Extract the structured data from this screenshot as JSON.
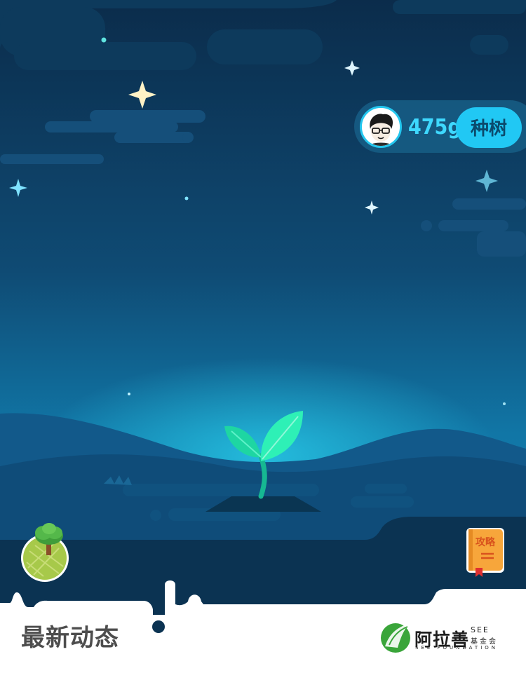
{
  "energy": {
    "amount": "475g",
    "plant_button_label": "种树"
  },
  "guide": {
    "label": "攻略"
  },
  "feed": {
    "title": "最新动态"
  },
  "partner": {
    "name": "阿拉善",
    "abbr": "SEE",
    "sub": "基金会",
    "foundation": "SEE FOUNDATION"
  },
  "icons": {
    "avatar": "user-avatar-icon",
    "tree": "tree-badge-icon",
    "guide": "guide-book-icon",
    "logo": "see-leaf-logo-icon",
    "sprout": "sprout-icon"
  },
  "colors": {
    "accent": "#21c8f4",
    "energy_text": "#3ed8ff",
    "sprout": "#1ed6a2",
    "sky_top": "#0b2c4b",
    "sky_bottom": "#1689b8"
  }
}
